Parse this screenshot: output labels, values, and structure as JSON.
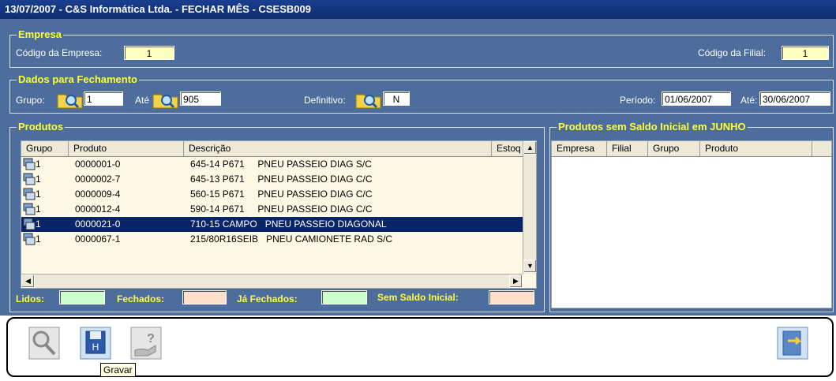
{
  "window": {
    "title": "13/07/2007  - C&S Informática Ltda. - FECHAR MÊS  - CSESB009"
  },
  "empresa": {
    "legend": "Empresa",
    "codigo_empresa_label": "Código da Empresa:",
    "codigo_empresa_value": "1",
    "codigo_filial_label": "Código da Filial:",
    "codigo_filial_value": "1"
  },
  "dados": {
    "legend": "Dados para Fechamento",
    "grupo_label": "Grupo:",
    "grupo_value": "1",
    "ate_label": "Até",
    "ate_value": "905",
    "definitivo_label": "Definitivo:",
    "definitivo_value": "N",
    "periodo_label": "Período:",
    "periodo_value": "01/06/2007",
    "ate2_label": "Até:",
    "ate2_value": "30/06/2007"
  },
  "produtos": {
    "legend": "Produtos",
    "columns": [
      "Grupo",
      "Produto",
      "Descrição",
      "Estoq"
    ],
    "rows": [
      {
        "grupo": "1",
        "produto": "0000001-0",
        "descricao": "645-14 P671     PNEU PASSEIO DIAG S/C"
      },
      {
        "grupo": "1",
        "produto": "0000002-7",
        "descricao": "645-13 P671     PNEU PASSEIO DIAG C/C"
      },
      {
        "grupo": "1",
        "produto": "0000009-4",
        "descricao": "560-15 P671     PNEU PASSEIO DIAG C/C"
      },
      {
        "grupo": "1",
        "produto": "0000012-4",
        "descricao": "590-14 P671     PNEU PASSEIO DIAG C/C"
      },
      {
        "grupo": "1",
        "produto": "0000021-0",
        "descricao": "710-15 CAMPO   PNEU PASSEIO DIAGONAL"
      },
      {
        "grupo": "1",
        "produto": "0000067-1",
        "descricao": "215/80R16SEIB   PNEU CAMIONETE RAD S/C"
      }
    ],
    "selected_index": 4,
    "lidos_label": "Lidos:",
    "lidos_value": "",
    "fechados_label": "Fechados:",
    "fechados_value": "",
    "ja_fechados_label": "Já Fechados:",
    "ja_fechados_value": "",
    "sem_saldo_label": "Sem Saldo Inicial:",
    "sem_saldo_value": ""
  },
  "sem_saldo": {
    "legend": "Produtos sem Saldo Inicial em JUNHO",
    "columns": [
      "Empresa",
      "Filial",
      "Grupo",
      "Produto"
    ]
  },
  "toolbar": {
    "tooltip": "Gravar"
  },
  "colors": {
    "title_bg": "#1a3f8f",
    "panel_bg": "#4d6d9c",
    "legend": "#ffff33",
    "selected_row": "#0a246a"
  }
}
